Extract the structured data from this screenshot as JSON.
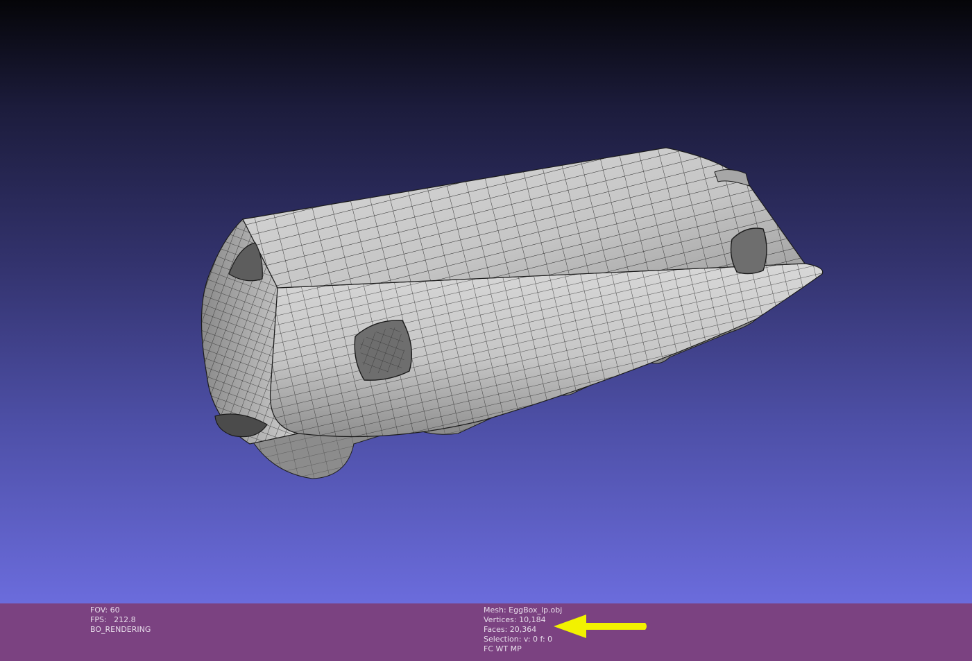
{
  "viewer": {
    "left_info": {
      "fov": "FOV: 60",
      "fps": "FPS:   212.8",
      "rendering": "BO_RENDERING"
    },
    "mesh_info": {
      "mesh": "Mesh: EggBox_lp.obj",
      "vertices": "Vertices: 10,184",
      "faces": "Faces: 20,364",
      "selection": "Selection: v: 0 f: 0",
      "flags": "FC WT MP"
    }
  },
  "annotation": {
    "arrow_color": "#f2f200",
    "points_to": "vertices-and-faces"
  },
  "colors": {
    "background_top": "#050508",
    "background_bottom": "#6b6cdc",
    "info_bar": "#7b4281",
    "mesh_fill": "#bdbdbd",
    "wireframe": "#222222"
  },
  "icons": {
    "annotation_arrow": "arrow-left-icon"
  }
}
